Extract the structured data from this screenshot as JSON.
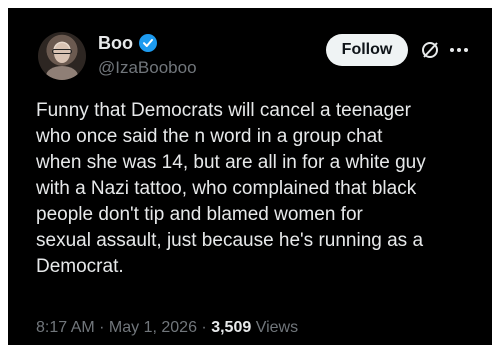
{
  "author": {
    "display_name": "Boo",
    "handle": "@IzaBooboo",
    "verified": true
  },
  "actions": {
    "follow_label": "Follow",
    "grok_icon": "grok-slash-circle-icon",
    "more_icon": "more-dots-icon"
  },
  "tweet": {
    "text": "Funny that Democrats will cancel a teenager\nwho once said the n word in a group chat\nwhen she was 14, but are all in for a white guy\nwith a Nazi tattoo, who complained that black\npeople don't tip and blamed women for\nsexual assault, just because he's running as a\nDemocrat."
  },
  "meta": {
    "time": "8:17 AM",
    "separator": " · ",
    "date": "May 1, 2026",
    "views_count": "3,509",
    "views_label": "Views"
  },
  "colors": {
    "background": "#000000",
    "text": "#e7e9ea",
    "secondary_text": "#71767b",
    "verified_blue": "#1d9bf0",
    "follow_bg": "#eff3f4"
  }
}
